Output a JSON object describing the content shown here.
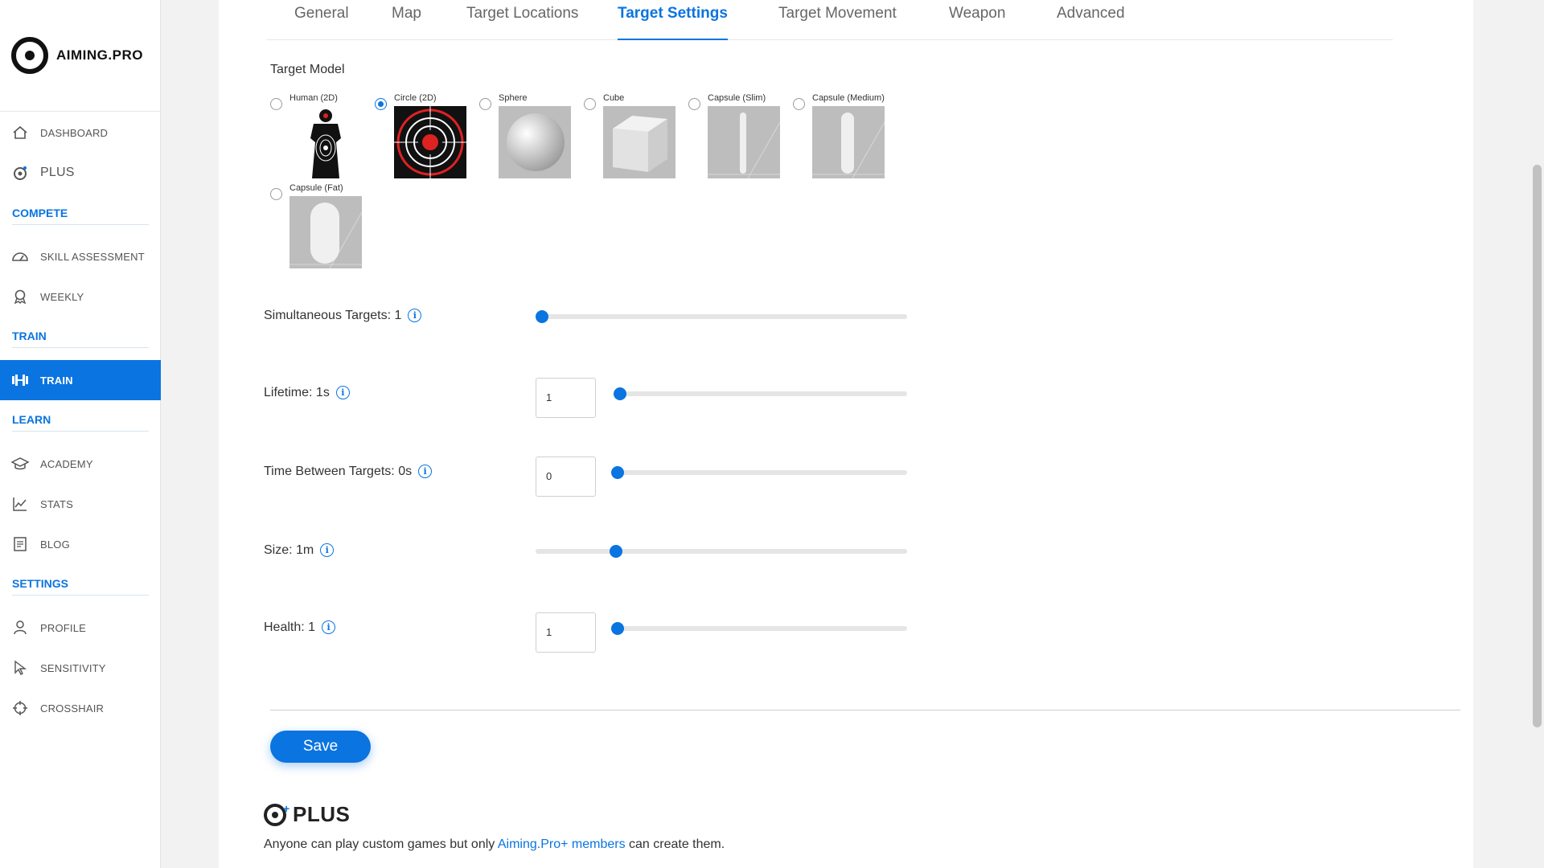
{
  "app": {
    "brand": "AIMING.PRO"
  },
  "sidebar": {
    "items": [
      {
        "label": "DASHBOARD",
        "icon": "home-icon"
      },
      {
        "label": "PLUS",
        "icon": "plus-logo-icon"
      },
      {
        "label": "SKILL ASSESSMENT",
        "icon": "gauge-icon"
      },
      {
        "label": "WEEKLY",
        "icon": "award-icon"
      },
      {
        "label": "TRAIN",
        "icon": "dumbbell-icon"
      },
      {
        "label": "ACADEMY",
        "icon": "graduation-cap-icon"
      },
      {
        "label": "STATS",
        "icon": "chart-line-icon"
      },
      {
        "label": "BLOG",
        "icon": "document-icon"
      },
      {
        "label": "PROFILE",
        "icon": "user-icon"
      },
      {
        "label": "SENSITIVITY",
        "icon": "cursor-icon"
      },
      {
        "label": "CROSSHAIR",
        "icon": "crosshair-icon"
      }
    ],
    "sections": [
      "COMPETE",
      "TRAIN",
      "LEARN",
      "SETTINGS"
    ],
    "active_color": "#0a74e0"
  },
  "tabs": [
    "General",
    "Map",
    "Target Locations",
    "Target Settings",
    "Target Movement",
    "Weapon",
    "Advanced"
  ],
  "active_tab": "Target Settings",
  "target_model": {
    "label": "Target Model",
    "options": [
      "Human (2D)",
      "Circle (2D)",
      "Sphere",
      "Cube",
      "Capsule (Slim)",
      "Capsule (Medium)",
      "Capsule (Fat)"
    ],
    "selected": "Circle (2D)"
  },
  "settings": {
    "simultaneous": {
      "label": "Simultaneous Targets: 1",
      "fraction": 0.0
    },
    "lifetime": {
      "label": "Lifetime: 1s",
      "value": "1",
      "fraction": 0.0
    },
    "time_between": {
      "label": "Time Between Targets: 0s",
      "value": "0",
      "fraction": 0.0
    },
    "size": {
      "label": "Size: 1m",
      "fraction": 0.2
    },
    "health": {
      "label": "Health: 1",
      "value": "1",
      "fraction": 0.0
    }
  },
  "actions": {
    "save_label": "Save"
  },
  "plus_promo": {
    "word": "PLUS",
    "text_before": "Anyone can play custom games but only ",
    "link": "Aiming.Pro+ members",
    "text_after": " can create them."
  }
}
